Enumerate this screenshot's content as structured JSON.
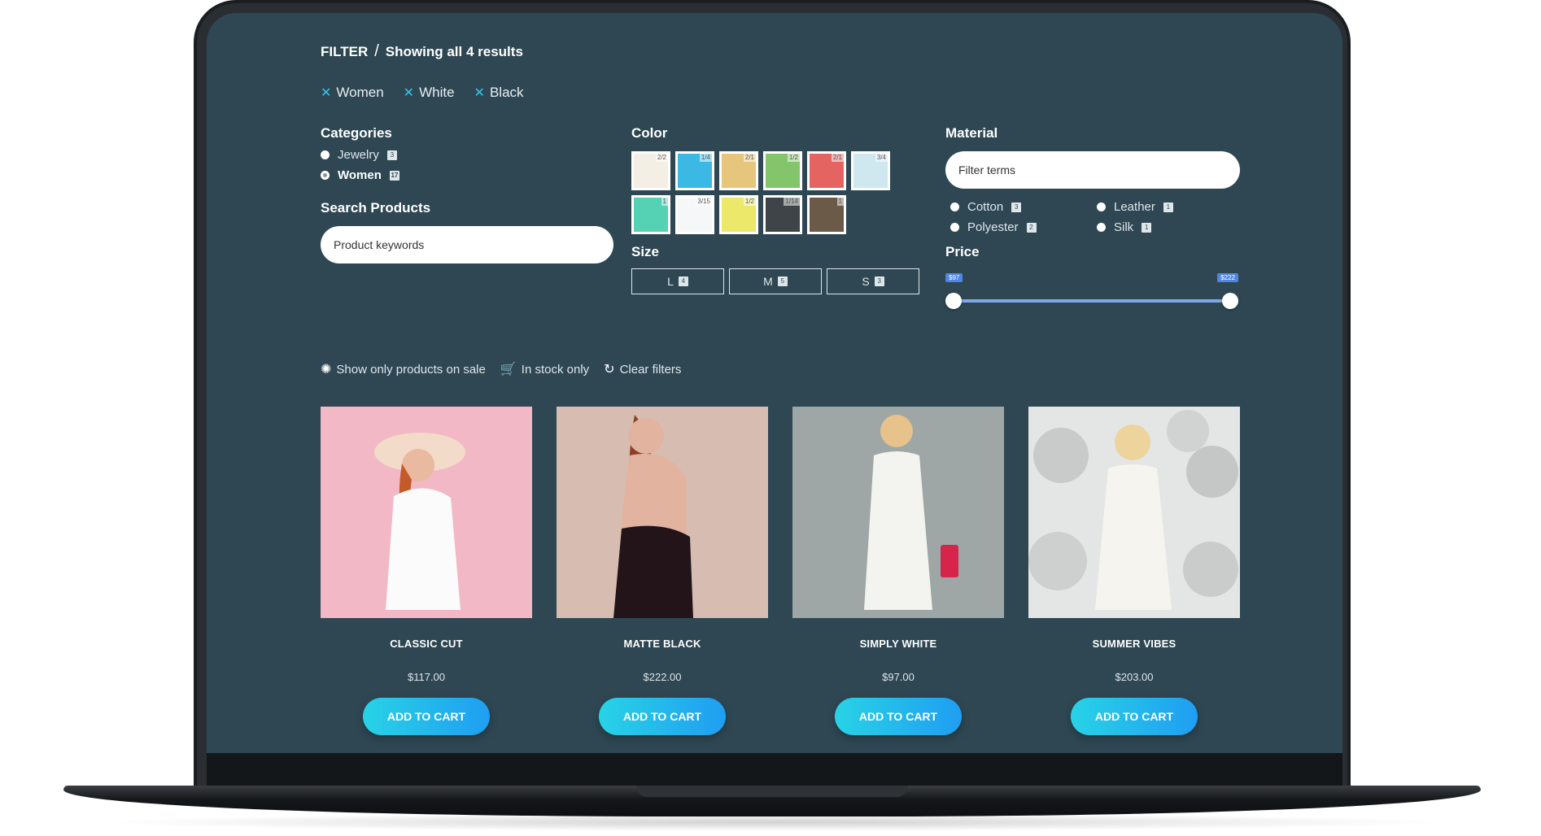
{
  "breadcrumb": {
    "filter": "FILTER",
    "separator": "/",
    "results": "Showing all 4 results"
  },
  "active_filters": [
    {
      "label": "Women"
    },
    {
      "label": "White"
    },
    {
      "label": "Black"
    }
  ],
  "categories": {
    "title": "Categories",
    "items": [
      {
        "label": "Jewelry",
        "count": "3",
        "selected": false
      },
      {
        "label": "Women",
        "count": "17",
        "selected": true
      }
    ]
  },
  "search_products": {
    "title": "Search Products",
    "placeholder": "Product keywords"
  },
  "color": {
    "title": "Color",
    "swatches": [
      {
        "color": "#f3efe4",
        "count": "2/2"
      },
      {
        "color": "#3bb8e3",
        "count": "1/4"
      },
      {
        "color": "#e6c57d",
        "count": "2/1"
      },
      {
        "color": "#84c46a",
        "count": "1/2"
      },
      {
        "color": "#e46462",
        "count": "2/1"
      },
      {
        "color": "#cfe7ef",
        "count": "3/4"
      },
      {
        "color": "#55d1b3",
        "count": "1"
      },
      {
        "color": "#f5f7f9",
        "count": "3/15"
      },
      {
        "color": "#ece86a",
        "count": "1/2"
      },
      {
        "color": "#3f4448",
        "count": "1/14"
      },
      {
        "color": "#6a5a47",
        "count": "1"
      }
    ]
  },
  "size": {
    "title": "Size",
    "options": [
      {
        "label": "L",
        "count": "4"
      },
      {
        "label": "M",
        "count": "5"
      },
      {
        "label": "S",
        "count": "3"
      }
    ]
  },
  "material": {
    "title": "Material",
    "placeholder": "Filter terms",
    "items": [
      {
        "label": "Cotton",
        "count": "3"
      },
      {
        "label": "Leather",
        "count": "1"
      },
      {
        "label": "Polyester",
        "count": "2"
      },
      {
        "label": "Silk",
        "count": "1"
      }
    ]
  },
  "price": {
    "title": "Price",
    "min_label": "$97",
    "max_label": "$222",
    "min": 97,
    "max": 222
  },
  "options": {
    "on_sale": "Show only products on sale",
    "in_stock": "In stock only",
    "clear": "Clear filters"
  },
  "products": [
    {
      "name": "CLASSIC CUT",
      "price": "$117.00",
      "button": "ADD TO CART",
      "bg": "#f2b8c6"
    },
    {
      "name": "MATTE BLACK",
      "price": "$222.00",
      "button": "ADD TO CART",
      "bg": "#d7bdb1"
    },
    {
      "name": "SIMPLY WHITE",
      "price": "$97.00",
      "button": "ADD TO CART",
      "bg": "#9ea7a6"
    },
    {
      "name": "SUMMER VIBES",
      "price": "$203.00",
      "button": "ADD TO CART",
      "bg": "#e4e6e6"
    }
  ],
  "colors": {
    "background": "#2e4753",
    "accent": "#33c7ee",
    "button_from": "#28d3e6",
    "button_to": "#1f9ef2"
  }
}
